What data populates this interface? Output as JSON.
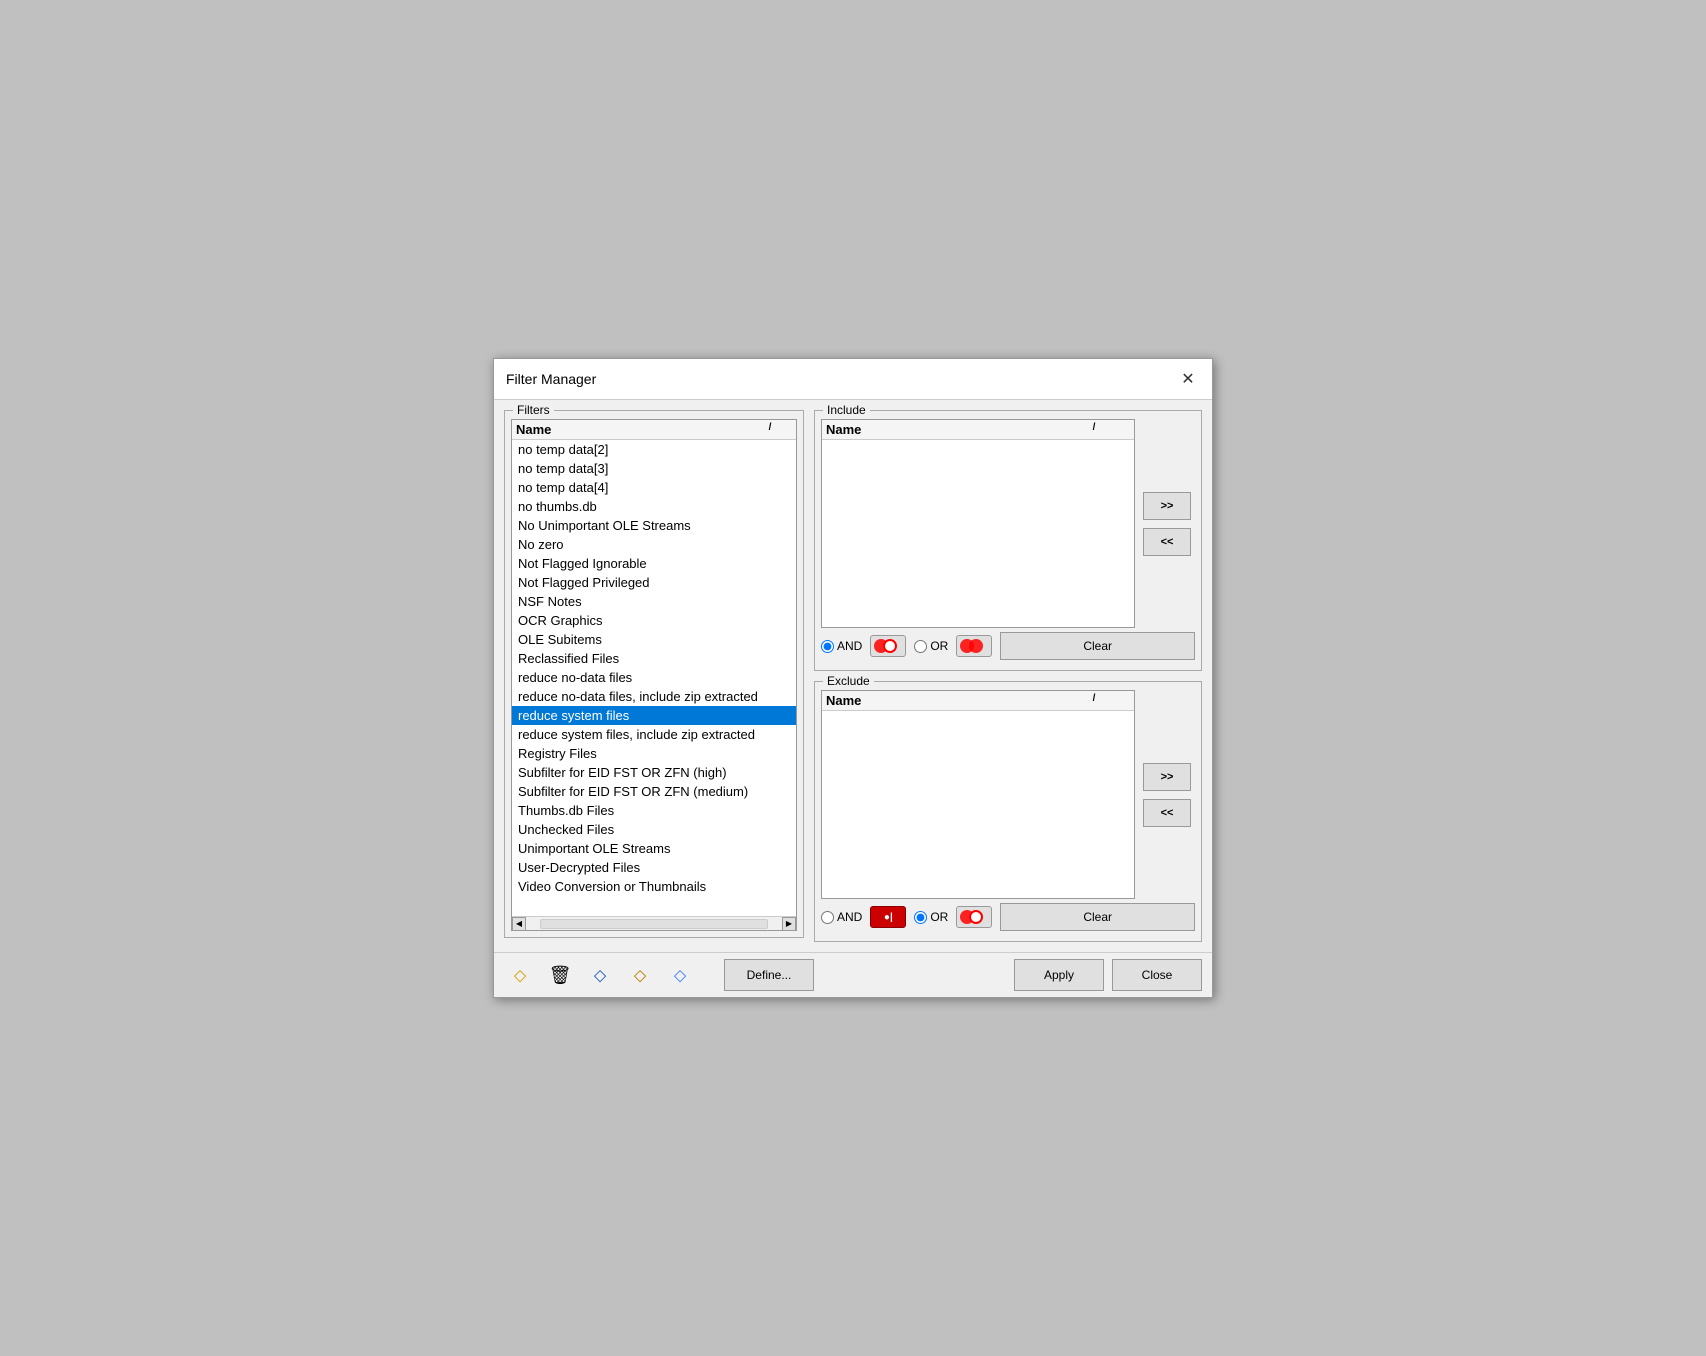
{
  "dialog": {
    "title": "Filter Manager",
    "close_label": "✕"
  },
  "filters_group": {
    "label": "Filters",
    "list_header": "Name",
    "list_header_sort": "/",
    "items": [
      {
        "label": "no temp data[2]",
        "selected": false
      },
      {
        "label": "no temp data[3]",
        "selected": false
      },
      {
        "label": "no temp data[4]",
        "selected": false
      },
      {
        "label": "no thumbs.db",
        "selected": false
      },
      {
        "label": "No Unimportant OLE Streams",
        "selected": false
      },
      {
        "label": "No zero",
        "selected": false
      },
      {
        "label": "Not Flagged Ignorable",
        "selected": false
      },
      {
        "label": "Not Flagged Privileged",
        "selected": false
      },
      {
        "label": "NSF Notes",
        "selected": false
      },
      {
        "label": "OCR Graphics",
        "selected": false
      },
      {
        "label": "OLE Subitems",
        "selected": false
      },
      {
        "label": "Reclassified Files",
        "selected": false
      },
      {
        "label": "reduce no-data files",
        "selected": false
      },
      {
        "label": "reduce no-data files, include zip extracted",
        "selected": false
      },
      {
        "label": "reduce system files",
        "selected": true
      },
      {
        "label": "reduce system files, include zip extracted",
        "selected": false
      },
      {
        "label": "Registry Files",
        "selected": false
      },
      {
        "label": "Subfilter for EID FST OR ZFN (high)",
        "selected": false
      },
      {
        "label": "Subfilter for EID FST OR ZFN (medium)",
        "selected": false
      },
      {
        "label": "Thumbs.db Files",
        "selected": false
      },
      {
        "label": "Unchecked Files",
        "selected": false
      },
      {
        "label": "Unimportant OLE Streams",
        "selected": false
      },
      {
        "label": "User-Decrypted Files",
        "selected": false
      },
      {
        "label": "Video Conversion or Thumbnails",
        "selected": false
      }
    ]
  },
  "include": {
    "label": "Include",
    "list_header": "Name",
    "list_header_sort": "/",
    "items": []
  },
  "exclude": {
    "label": "Exclude",
    "list_header": "Name",
    "list_header_sort": "/",
    "items": []
  },
  "buttons": {
    "add_to_include": ">>",
    "remove_from_include": "<<",
    "add_to_exclude": ">>",
    "remove_from_exclude": "<<",
    "include_clear": "Clear",
    "exclude_clear": "Clear",
    "define": "Define...",
    "apply": "Apply",
    "close": "Close"
  },
  "include_logic": {
    "and_label": "AND",
    "or_label": "OR",
    "and_selected": true,
    "or_selected": false
  },
  "exclude_logic": {
    "and_label": "AND",
    "or_label": "OR",
    "and_selected": false,
    "or_selected": true
  },
  "toolbar": {
    "filter_icon": "🔽",
    "delete_icon": "🗑",
    "filter2_icon": "🔽",
    "filter3_icon": "🔽",
    "filter4_icon": "🔽"
  }
}
